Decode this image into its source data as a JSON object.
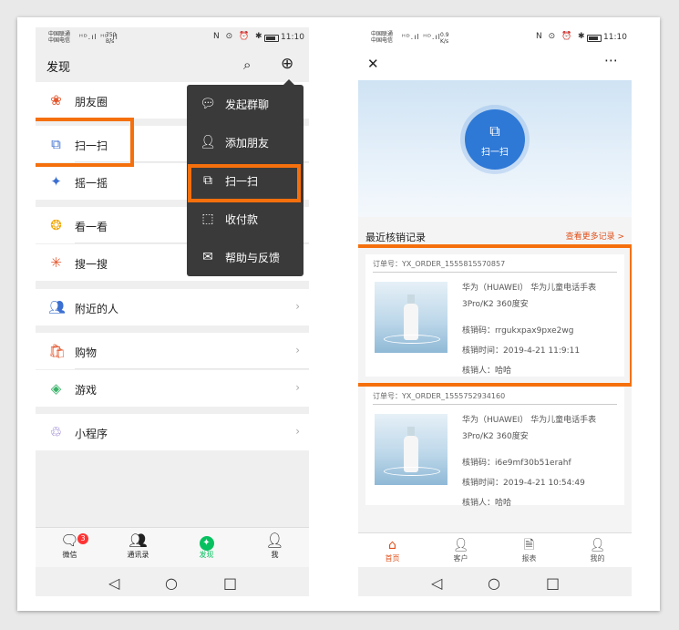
{
  "left_phone": {
    "status": {
      "carrier1": "中国联通",
      "carrier2": "中国电信",
      "signal": "ᴴᴰ.ıl ᴴᴰ.ıl",
      "speed": "750",
      "speed_unit": "B/s",
      "icons": "N ⊙ ⏰ ✱",
      "time": "11:10"
    },
    "header": {
      "title": "发现"
    },
    "menu": [
      {
        "label": "朋友圈",
        "icon": "moments-icon",
        "color": "#e4572e"
      },
      {
        "label": "扫一扫",
        "icon": "scan-icon",
        "color": "#3b6fd1"
      },
      {
        "label": "摇一摇",
        "icon": "shake-icon",
        "color": "#3b6fd1"
      },
      {
        "label": "看一看",
        "icon": "look-icon",
        "color": "#f0a500"
      },
      {
        "label": "搜一搜",
        "icon": "search-icon",
        "color": "#e4572e"
      },
      {
        "label": "附近的人",
        "icon": "nearby-icon",
        "color": "#3b6fd1"
      },
      {
        "label": "购物",
        "icon": "shopping-icon",
        "color": "#e4572e"
      },
      {
        "label": "游戏",
        "icon": "game-icon",
        "color": "#3bb26a"
      },
      {
        "label": "小程序",
        "icon": "miniprogram-icon",
        "color": "#7b5cc7"
      }
    ],
    "popup": [
      {
        "label": "发起群聊",
        "icon": "chat-icon"
      },
      {
        "label": "添加朋友",
        "icon": "add-friend-icon"
      },
      {
        "label": "扫一扫",
        "icon": "scan-icon"
      },
      {
        "label": "收付款",
        "icon": "payment-icon"
      },
      {
        "label": "帮助与反馈",
        "icon": "mail-icon"
      }
    ],
    "tabs": [
      {
        "label": "微信",
        "badge": "3"
      },
      {
        "label": "通讯录"
      },
      {
        "label": "发现"
      },
      {
        "label": "我"
      }
    ],
    "accent": "#07c160",
    "highlight_color": "#f5700d"
  },
  "right_phone": {
    "status": {
      "carrier1": "中国联通",
      "carrier2": "中国电信",
      "signal": "ᴴᴰ.ıl ᴴᴰ.ıl",
      "speed": "0.9",
      "speed_unit": "K/s",
      "icons": "N ⊙ ⏰ ✱",
      "time": "11:10"
    },
    "scan_label": "扫一扫",
    "section_title": "最近核销记录",
    "more_link": "查看更多记录 >",
    "records": [
      {
        "order": "订单号：YX_ORDER_1555815570857",
        "name": "华为（HUAWEI） 华为儿童电话手表3Pro/K2 360度安",
        "code": "核销码：rrgukxpax9pxe2wg",
        "time": "核销时间：2019-4-21 11:9:11",
        "person": "核销人：哈哈"
      },
      {
        "order": "订单号：YX_ORDER_1555752934160",
        "name": "华为（HUAWEI） 华为儿童电话手表3Pro/K2 360度安",
        "code": "核销码：i6e9mf30b51erahf",
        "time": "核销时间：2019-4-21 10:54:49",
        "person": "核销人：哈哈"
      }
    ],
    "tabs": [
      {
        "label": "首页"
      },
      {
        "label": "客户"
      },
      {
        "label": "报表"
      },
      {
        "label": "我的"
      }
    ],
    "accent": "#e0501a",
    "button_color": "#2e78d6"
  }
}
